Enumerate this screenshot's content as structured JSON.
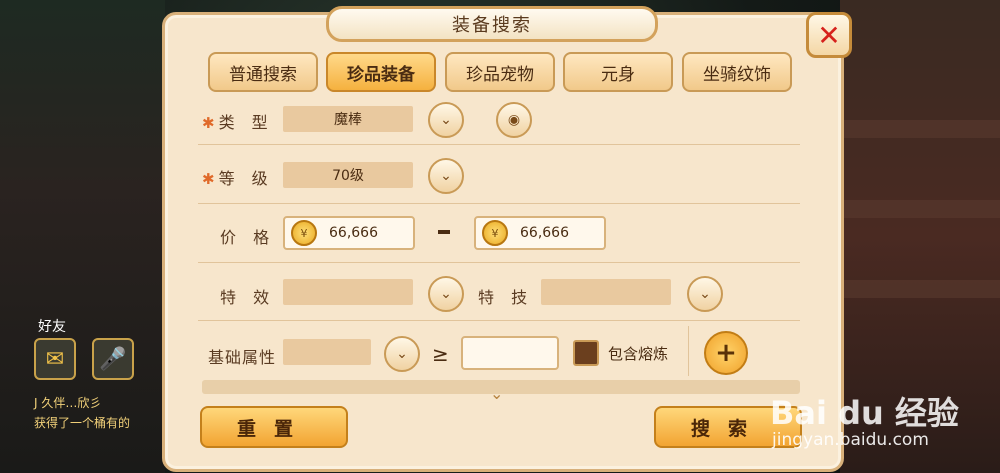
{
  "window": {
    "title": "装备搜索"
  },
  "tabs": [
    {
      "label": "普通搜索"
    },
    {
      "label": "珍品装备"
    },
    {
      "label": "珍品宠物"
    },
    {
      "label": "元身"
    },
    {
      "label": "坐骑纹饰"
    }
  ],
  "active_tab": 1,
  "form": {
    "type": {
      "label": "类 型",
      "value": "魔棒"
    },
    "level": {
      "label": "等 级",
      "value": "70级"
    },
    "price": {
      "label": "价 格",
      "min": "66,666",
      "separator": "-",
      "max": "66,666"
    },
    "effect": {
      "label": "特 效",
      "value": ""
    },
    "skill": {
      "label": "特 技",
      "value": ""
    },
    "base_attr": {
      "label": "基础属性",
      "value": "",
      "comparator": "≥",
      "threshold": ""
    },
    "include_smelt": {
      "label": "包含熔炼",
      "checked": false
    }
  },
  "buttons": {
    "reset": "重置",
    "search": "搜索"
  },
  "background": {
    "friend_label": "好友",
    "chat_line_1": "J 久伴…欣彡",
    "chat_line_2": "获得了一个桶有的"
  },
  "watermark": {
    "brand": "Bai du 经验",
    "url": "jingyan.baidu.com"
  },
  "colors": {
    "accent": "#f2a432",
    "panel": "#f7e6cc",
    "close": "#d6221c"
  },
  "icons": [
    "close-icon",
    "chevron-down-icon",
    "eye-icon",
    "coin-icon",
    "plus-icon",
    "expand-icon",
    "chat-icon",
    "mic-icon"
  ]
}
